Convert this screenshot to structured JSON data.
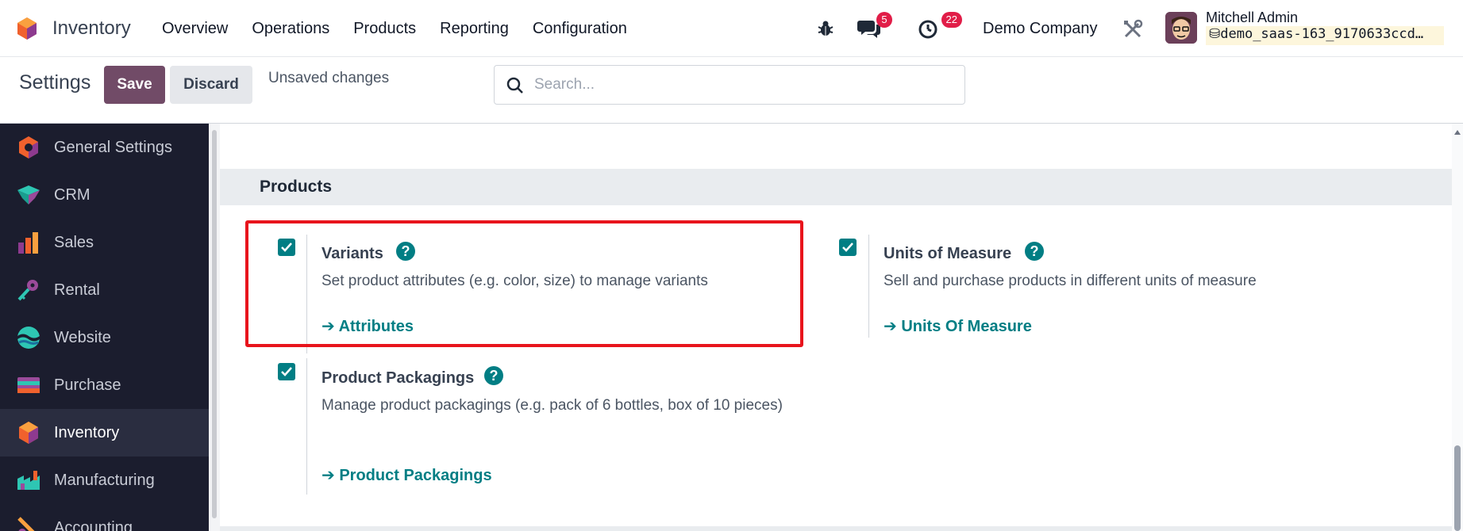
{
  "navbar": {
    "app_name": "Inventory",
    "menu": [
      "Overview",
      "Operations",
      "Products",
      "Reporting",
      "Configuration"
    ],
    "messages_count": "5",
    "activities_count": "22",
    "company": "Demo Company",
    "user_name": "Mitchell Admin",
    "database": "demo_saas-163_9170633ccd…"
  },
  "control_panel": {
    "title": "Settings",
    "save_label": "Save",
    "discard_label": "Discard",
    "status": "Unsaved changes",
    "search_placeholder": "Search..."
  },
  "sidebar": {
    "items": [
      {
        "label": "General Settings",
        "icon": "general-settings-icon"
      },
      {
        "label": "CRM",
        "icon": "crm-icon"
      },
      {
        "label": "Sales",
        "icon": "sales-icon"
      },
      {
        "label": "Rental",
        "icon": "rental-icon"
      },
      {
        "label": "Website",
        "icon": "website-icon"
      },
      {
        "label": "Purchase",
        "icon": "purchase-icon"
      },
      {
        "label": "Inventory",
        "icon": "inventory-icon",
        "active": true
      },
      {
        "label": "Manufacturing",
        "icon": "manufacturing-icon"
      },
      {
        "label": "Accounting",
        "icon": "accounting-icon"
      }
    ]
  },
  "section": {
    "title": "Products",
    "settings": [
      {
        "title": "Variants",
        "checked": true,
        "description": "Set product attributes (e.g. color, size) to manage variants",
        "link": "Attributes"
      },
      {
        "title": "Units of Measure",
        "checked": true,
        "description": "Sell and purchase products in different units of measure",
        "link": "Units Of Measure"
      },
      {
        "title": "Product Packagings",
        "checked": true,
        "description": "Manage product packagings (e.g. pack of 6 bottles, box of 10 pieces)",
        "link": "Product Packagings"
      }
    ]
  },
  "colors": {
    "brand": "#714b67",
    "accent": "#017e84",
    "highlight": "#e8141c",
    "sidebar_bg": "#1b1d2e"
  }
}
